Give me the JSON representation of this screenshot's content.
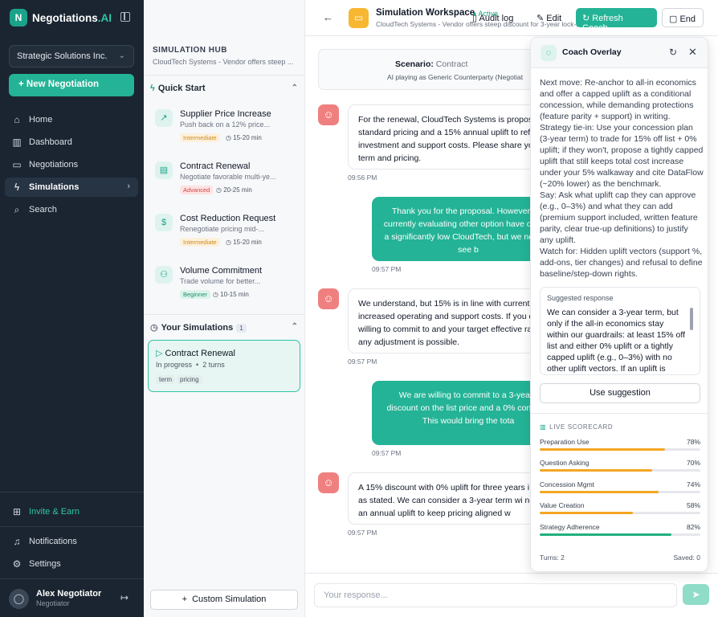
{
  "app": {
    "name": "Negotiations",
    "name_suffix": ".AI",
    "logo_letter": "N"
  },
  "sidebar": {
    "org": "Strategic Solutions Inc.",
    "new_button": "New Negotiation",
    "nav": [
      {
        "label": "Home",
        "icon": "home-icon"
      },
      {
        "label": "Dashboard",
        "icon": "chart-icon"
      },
      {
        "label": "Negotiations",
        "icon": "message-icon"
      },
      {
        "label": "Simulations",
        "icon": "bolt-icon"
      },
      {
        "label": "Search",
        "icon": "search-icon"
      }
    ],
    "invite": "Invite & Earn",
    "notifications": "Notifications",
    "settings": "Settings",
    "user": {
      "name": "Alex Negotiator",
      "role": "Negotiator"
    }
  },
  "panel": {
    "hub_title": "SIMULATION HUB",
    "hub_sub": "CloudTech Systems - Vendor offers steep ...",
    "quick_start": "Quick Start",
    "cards": [
      {
        "title": "Supplier Price Increase",
        "desc": "Push back on a 12% price...",
        "level": "Intermediate",
        "time": "15-20 min"
      },
      {
        "title": "Contract Renewal",
        "desc": "Negotiate favorable multi-ye...",
        "level": "Advanced",
        "time": "20-25 min"
      },
      {
        "title": "Cost Reduction Request",
        "desc": "Renegotiate pricing mid-...",
        "level": "Intermediate",
        "time": "15-20 min"
      },
      {
        "title": "Volume Commitment",
        "desc": "Trade volume for better...",
        "level": "Beginner",
        "time": "10-15 min"
      }
    ],
    "your_sims": "Your Simulations",
    "your_count": "1",
    "sim": {
      "title": "Contract Renewal",
      "status": "In progress",
      "turns": "2 turns",
      "tags": [
        "term",
        "pricing"
      ]
    },
    "custom_button": "Custom Simulation"
  },
  "main": {
    "title": "Simulation Workspace",
    "status": "Active",
    "subtitle": "CloudTech Systems - Vendor offers steep discount for 3-year lock-in",
    "actions": {
      "audit": "Audit log",
      "edit": "Edit",
      "refresh": "Refresh Coach",
      "end": "End"
    },
    "scenario_label": "Scenario:",
    "scenario_value": "Contract",
    "scenario_sub": "AI playing as Generic Counterparty (Negotiat",
    "messages": [
      {
        "from": "bot",
        "text": "For the renewal, CloudTech Systems is propos standard pricing and a 15% annual uplift to refl investment and support costs. Please share yo term and pricing.",
        "time": "09:56 PM"
      },
      {
        "from": "me",
        "text": "Thank you for the proposal. However are currently evaluating other option have offered a significantly low CloudTech, but we need to see b",
        "time": "09:57 PM"
      },
      {
        "from": "bot",
        "text": "We understand, but 15% is in line with current increased operating and support costs. If you c willing to commit to and your target effective ra any adjustment is possible.",
        "time": "09:57 PM"
      },
      {
        "from": "me",
        "text": "We are willing to commit to a 3-year t discount on the list price and a 0% contract. This would bring the tota",
        "time": "09:57 PM"
      },
      {
        "from": "bot",
        "text": "A 15% discount with 0% uplift for three years i to as stated. We can consider a 3-year term wi need an annual uplift to keep pricing aligned w",
        "time": "09:57 PM"
      }
    ],
    "input_placeholder": "Your response..."
  },
  "coach": {
    "title": "Coach Overlay",
    "advice": [
      "Next move: Re-anchor to all-in economics and offer a capped uplift as a conditional concession, while demanding protections (feature parity + support) in writing.",
      "Strategy tie-in: Use your concession plan (3-year term) to trade for 15% off list + 0% uplift; if they won't, propose a tightly capped uplift that still keeps total cost increase under your 5% walkaway and cite DataFlow (~20% lower) as the benchmark.",
      "Say: Ask what uplift cap they can approve (e.g., 0–3%) and what they can add (premium support included, written feature parity, clear true-up definitions) to justify any uplift.",
      "Watch for: Hidden uplift vectors (support %, add-ons, tier changes) and refusal to define baseline/step-down rights."
    ],
    "suggested_label": "Suggested response",
    "suggested_text": "We can consider a 3-year term, but only if the all-in economics stay within our guardrails: at least 15% off list and either 0% uplift or a tightly capped uplift (e.g., 0–3%) with no other uplift vectors. If an uplift is",
    "use_button": "Use suggestion",
    "scorecard_title": "LIVE SCORECARD",
    "metrics": [
      {
        "name": "Preparation Use",
        "label": "78%",
        "value": 0.78,
        "color": "#f5a623"
      },
      {
        "name": "Question Asking",
        "label": "70%",
        "value": 0.7,
        "color": "#f5a623"
      },
      {
        "name": "Concession Mgmt",
        "label": "74%",
        "value": 0.74,
        "color": "#f5a623"
      },
      {
        "name": "Value Creation",
        "label": "58%",
        "value": 0.58,
        "color": "#f5a623"
      },
      {
        "name": "Strategy Adherence",
        "label": "82%",
        "value": 0.82,
        "color": "#22b07d"
      }
    ],
    "turns": "Turns: 2",
    "saved": "Saved: 0"
  }
}
